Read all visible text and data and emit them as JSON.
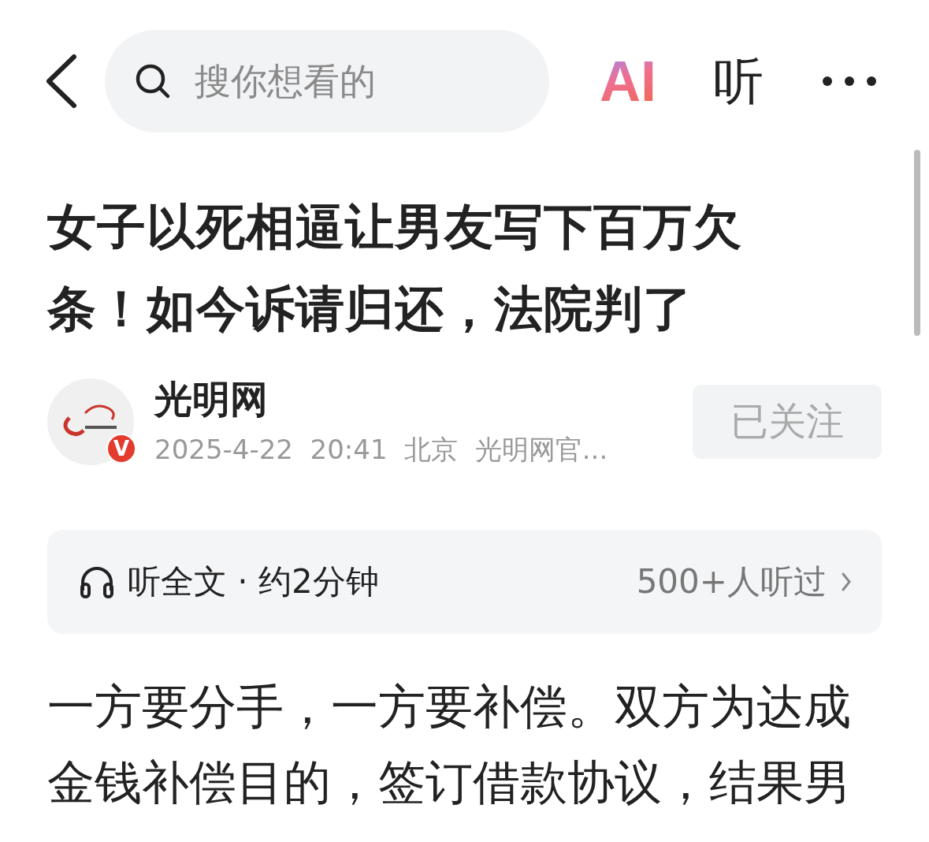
{
  "top_bar": {
    "search": {
      "placeholder": "搜你想看的"
    },
    "ai_logo": "AI",
    "listen_button": "听"
  },
  "article": {
    "title": "女子以死相逼让男友写下百万欠条！如今诉请归还，法院判了",
    "author": {
      "name": "光明网",
      "verified_badge": "V",
      "meta": "2025-4-22  20:41  北京  光明网官...",
      "follow_button": {
        "label": "已关注",
        "followed": true
      }
    },
    "listen_card": {
      "label": "听全文 · 约2分钟",
      "count": "500+人听过"
    },
    "body": "一方要分手，一方要补偿。双方为达成金钱补偿目的，签订借款协议，结果男"
  }
}
